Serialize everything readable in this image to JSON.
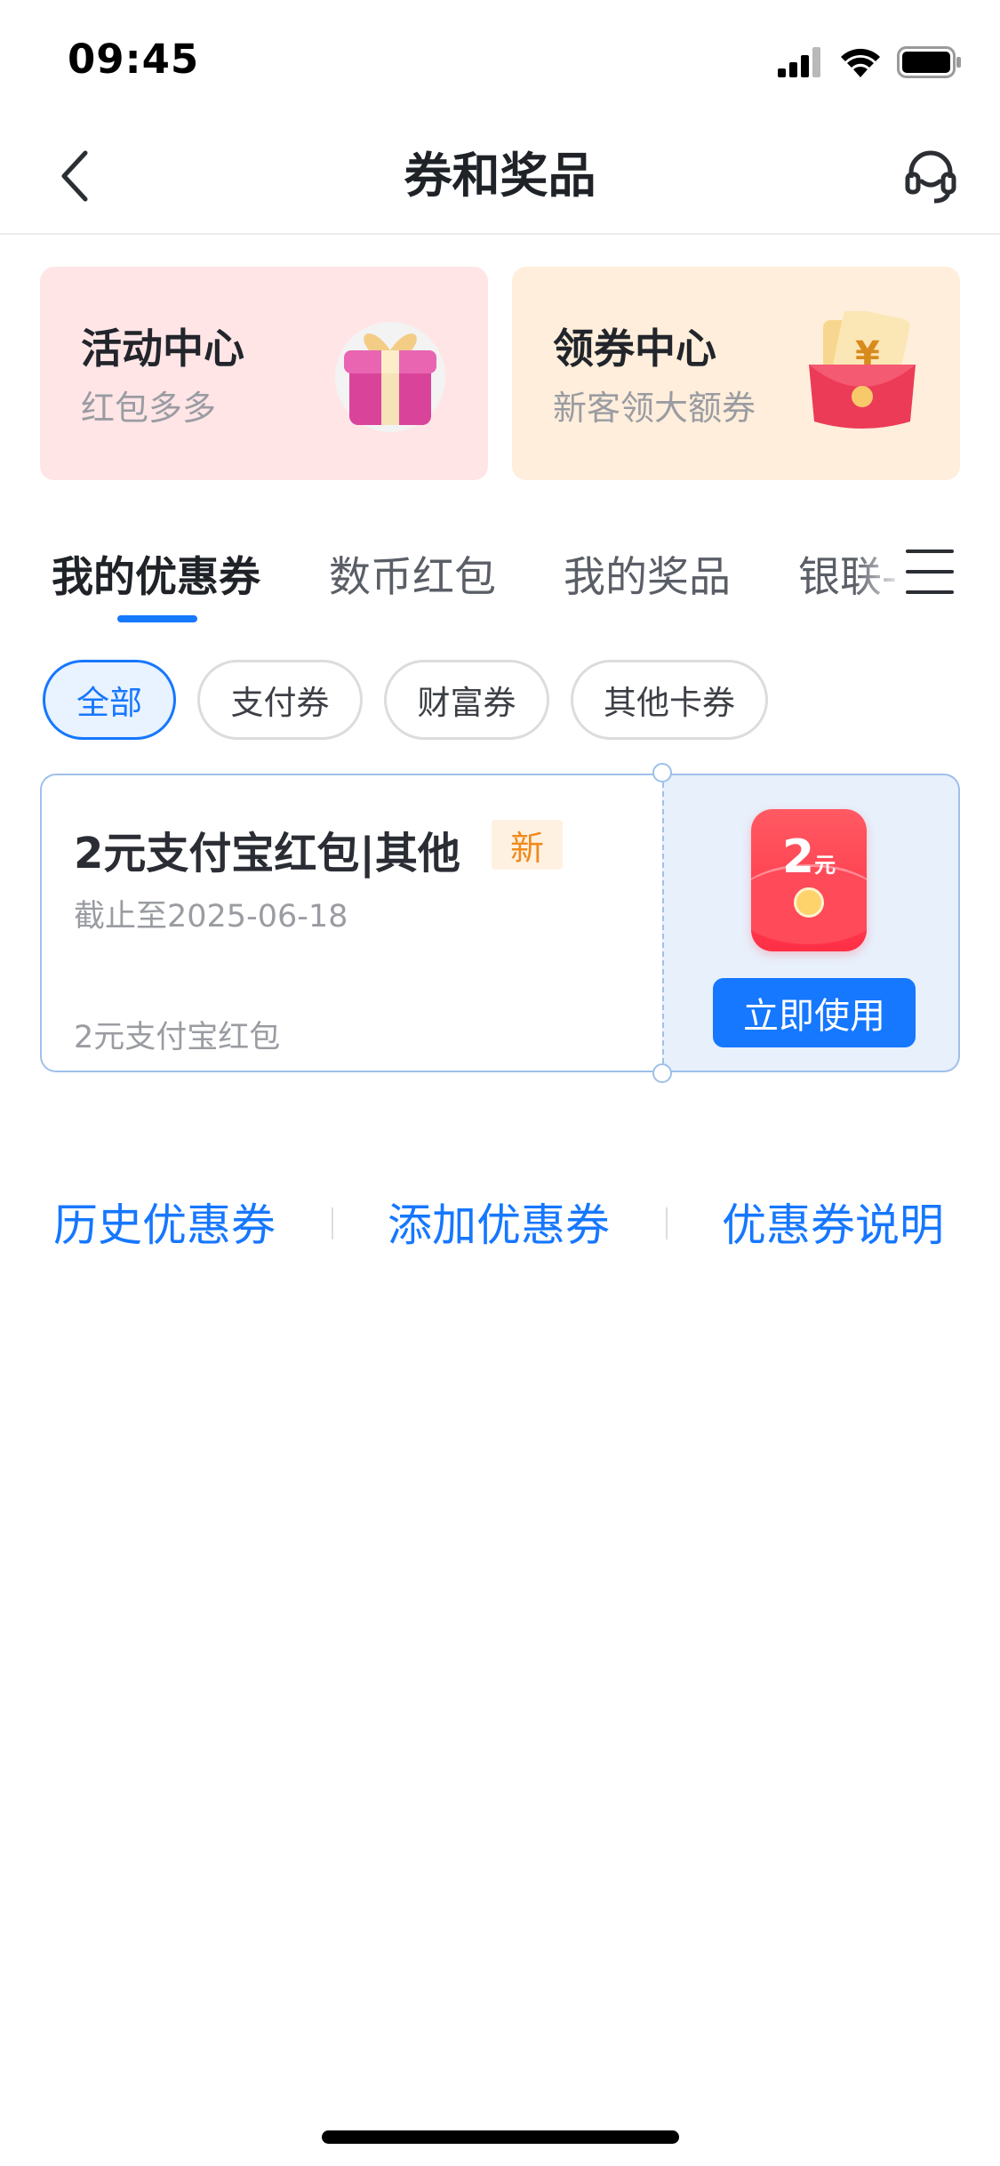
{
  "status_bar": {
    "time": "09:45"
  },
  "nav": {
    "title": "券和奖品"
  },
  "promos": [
    {
      "title": "活动中心",
      "subtitle": "红包多多"
    },
    {
      "title": "领券中心",
      "subtitle": "新客领大额券"
    }
  ],
  "tabs": [
    {
      "label": "我的优惠券",
      "active": true
    },
    {
      "label": "数币红包"
    },
    {
      "label": "我的奖品"
    },
    {
      "label": "银联-"
    }
  ],
  "chips": [
    {
      "label": "全部",
      "active": true
    },
    {
      "label": "支付券"
    },
    {
      "label": "财富券"
    },
    {
      "label": "其他卡券"
    }
  ],
  "coupon": {
    "title": "2元支付宝红包|其他",
    "badge": "新",
    "expiry": "截止至2025-06-18",
    "description": "2元支付宝红包",
    "amount": "2",
    "amount_unit": "元",
    "action_label": "立即使用"
  },
  "footer_links": [
    "历史优惠券",
    "添加优惠券",
    "优惠券说明"
  ],
  "colors": {
    "accent": "#1677ff",
    "activity_card_bg": "#ffe5e6",
    "coupon_center_bg": "#ffeedb",
    "new_badge": "#f08a1c"
  }
}
